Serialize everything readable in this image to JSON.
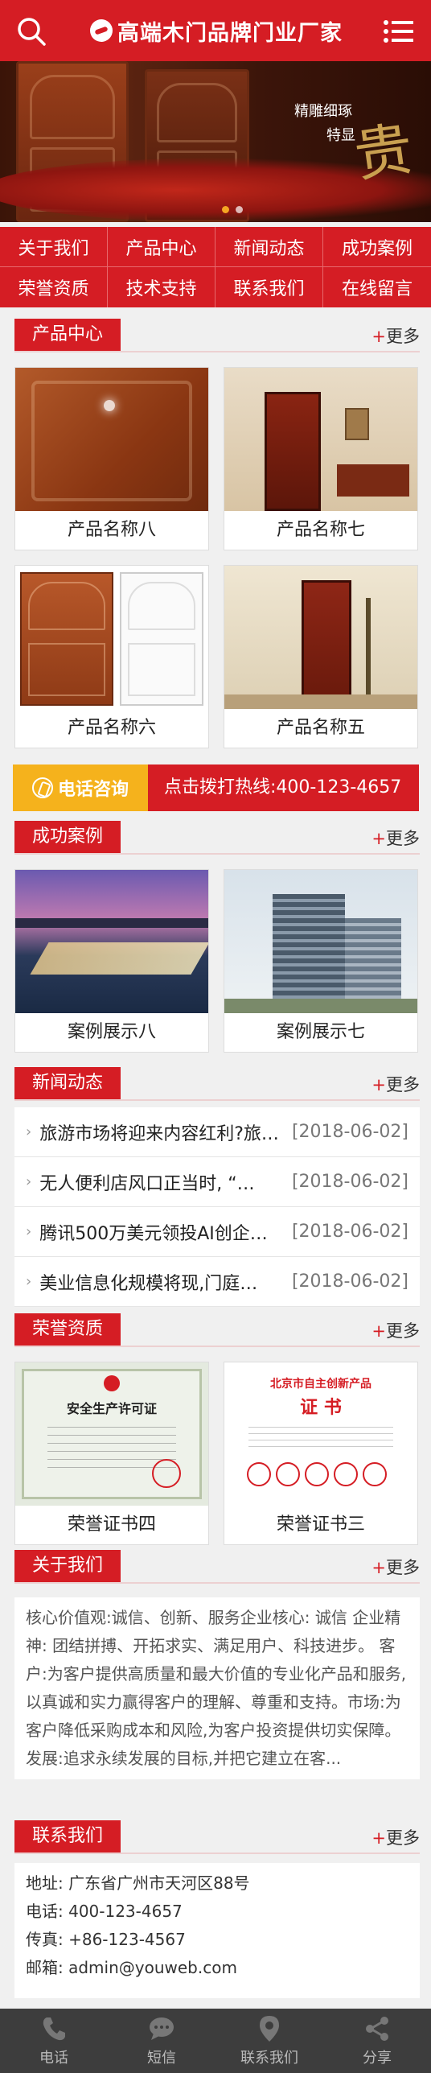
{
  "header": {
    "title": "高端木门品牌门业厂家"
  },
  "banner": {
    "tagline1": "精雕细琢",
    "tagline2": "特显",
    "calligraphy": "贵"
  },
  "quick_nav": [
    "关于我们",
    "产品中心",
    "新闻动态",
    "成功案例",
    "荣誉资质",
    "技术支持",
    "联系我们",
    "在线留言"
  ],
  "more_label": "+更多",
  "products": {
    "title": "产品中心",
    "items": [
      "产品名称八",
      "产品名称七",
      "产品名称六",
      "产品名称五"
    ]
  },
  "phone": {
    "label": "电话咨询",
    "text": "点击拨打热线:400-123-4657"
  },
  "cases": {
    "title": "成功案例",
    "items": [
      "案例展示八",
      "案例展示七"
    ]
  },
  "news": {
    "title": "新闻动态",
    "items": [
      {
        "title": "旅游市场将迎来内容红利?旅游…",
        "date": "[2018-06-02]"
      },
      {
        "title": "无人便利店风口正当时, “…",
        "date": "[2018-06-02]"
      },
      {
        "title": "腾讯500万美元领投AI创企…",
        "date": "[2018-06-02]"
      },
      {
        "title": "美业信息化规模将现,门庭…",
        "date": "[2018-06-02]"
      }
    ]
  },
  "honors": {
    "title": "荣誉资质",
    "items": [
      "荣誉证书四",
      "荣誉证书三"
    ],
    "cert1_title": "安全生产许可证",
    "cert2_head": "北京市自主创新产品",
    "cert2_title": "证 书"
  },
  "about": {
    "title": "关于我们",
    "text": "核心价值观:诚信、创新、服务企业核心: 诚信 企业精神: 团结拼搏、开拓求实、满足用户、科技进步。 客户:为客户提供高质量和最大价值的专业化产品和服务,以真诚和实力赢得客户的理解、尊重和支持。市场:为客户降低采购成本和风险,为客户投资提供切实保障。 发展:追求永续发展的目标,并把它建立在客..."
  },
  "contact": {
    "title": "联系我们",
    "lines": [
      "地址: 广东省广州市天河区88号",
      "电话: 400-123-4657",
      "传真: +86-123-4567",
      "邮箱: admin@youweb.com"
    ]
  },
  "tabbar": [
    "电话",
    "短信",
    "联系我们",
    "分享"
  ],
  "colors": {
    "primary": "#d51d24",
    "accent": "#f5b21c",
    "tabbar_bg": "#3d3d3d"
  }
}
